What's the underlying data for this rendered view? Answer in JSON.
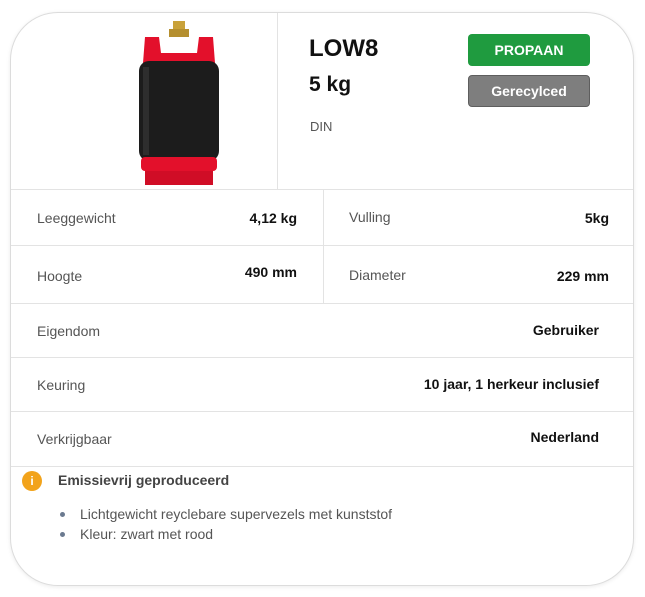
{
  "product": {
    "name": "LOW8",
    "weight": "5 kg",
    "norm": "DIN",
    "gas_type_label": "PROPAAN",
    "material_label": "Gerecylced"
  },
  "specs": [
    {
      "label": "Leeggewicht",
      "value": "4,12 kg",
      "label2": "Vulling",
      "value2": "5kg"
    },
    {
      "label": "Hoogte",
      "value": "490 mm",
      "label2": "Diameter",
      "value2": "229 mm"
    },
    {
      "label": "Eigendom",
      "value": "Gebruiker"
    },
    {
      "label": "Keuring",
      "value": "10 jaar, 1 herkeur inclusief"
    },
    {
      "label": "Verkrijgbaar",
      "value": "Nederland"
    }
  ],
  "info": {
    "icon_text": "i",
    "title": "Emissievrij geproduceerd",
    "bullets": [
      "Lichtgewicht reyclebare supervezels met kunststof",
      "Kleur: zwart met rood"
    ]
  },
  "colors": {
    "propaan": "#1f9b3f",
    "gerecycled": "#7e7e7e",
    "info_icon": "#f2a31b",
    "cylinder_body": "#1c1c1c",
    "cylinder_accent": "#e3102b"
  }
}
